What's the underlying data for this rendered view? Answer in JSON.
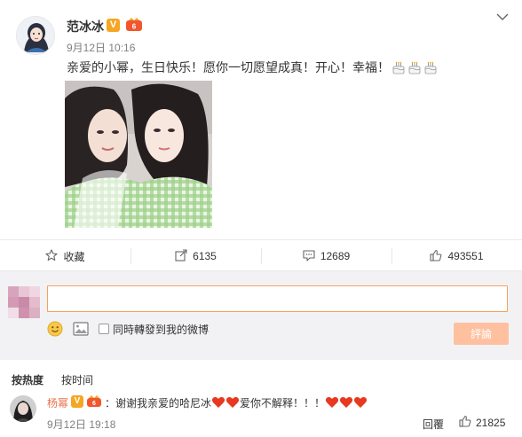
{
  "post": {
    "username": "范冰冰",
    "verified_badge": "V",
    "time": "9月12日 10:16",
    "text": "亲爱的小幂，生日快乐！愿你一切愿望成真！开心！幸福！",
    "emoji": [
      "cake-emoji",
      "cake-emoji",
      "cake-emoji"
    ],
    "menu_icon": "chevron-down-icon"
  },
  "actions": {
    "favorite": {
      "label": "收藏",
      "icon": "star-icon"
    },
    "repost": {
      "count": "6135",
      "icon": "share-icon"
    },
    "comment": {
      "count": "12689",
      "icon": "comment-icon"
    },
    "like": {
      "count": "493551",
      "icon": "thumbs-up-icon"
    }
  },
  "composer": {
    "input_value": "",
    "input_placeholder": "",
    "also_repost_label": "同時轉發到我的微博",
    "submit_label": "評論",
    "emoji_icon": "smiley-icon",
    "image_icon": "image-icon"
  },
  "sort": {
    "hot_label": "按热度",
    "time_label": "按时间"
  },
  "comment": {
    "username": "杨幂",
    "verified_badge": "V",
    "text_before": "：谢谢我亲爱的哈尼冰",
    "text_middle": "爱你不解释！！！",
    "time": "9月12日 19:18",
    "reply_label": "回覆",
    "like_count": "21825"
  },
  "colors": {
    "accent": "#eb7350",
    "input_border": "#f5a05c",
    "submit_bg": "#ffc09f",
    "composer_bg": "#f2f2f5",
    "badge": "#f5a623"
  }
}
